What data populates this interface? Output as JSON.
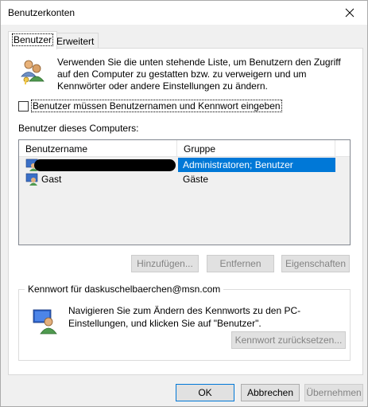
{
  "window": {
    "title": "Benutzerkonten"
  },
  "tabs": [
    {
      "label": "Benutzer"
    },
    {
      "label": "Erweitert"
    }
  ],
  "intro": {
    "text": "Verwenden Sie die unten stehende Liste, um Benutzern den Zugriff auf den Computer zu gestatten bzw. zu verweigern und um Kennwörter oder andere Einstellungen zu ändern."
  },
  "require_login": {
    "label": "Benutzer müssen Benutzernamen und Kennwort eingeben",
    "checked": false
  },
  "users_section": {
    "label": "Benutzer dieses Computers:"
  },
  "listview": {
    "columns": [
      {
        "label": "Benutzername"
      },
      {
        "label": "Gruppe"
      }
    ],
    "rows": [
      {
        "name": "",
        "group": "Administratoren; Benutzer",
        "selected": true,
        "redacted": true
      },
      {
        "name": "Gast",
        "group": "Gäste",
        "selected": false
      }
    ]
  },
  "buttons": {
    "add": "Hinzufügen...",
    "remove": "Entfernen",
    "properties": "Eigenschaften"
  },
  "password_group": {
    "title": "Kennwort für daskuschelbaerchen@msn.com",
    "text": "Navigieren Sie zum Ändern des Kennworts zu den PC-Einstellungen, und klicken Sie auf \"Benutzer\".",
    "reset_button": "Kennwort zurücksetzen..."
  },
  "footer": {
    "ok": "OK",
    "cancel": "Abbrechen",
    "apply": "Übernehmen"
  },
  "colors": {
    "selection": "#0078d7",
    "default_button_border": "#0078d7"
  }
}
